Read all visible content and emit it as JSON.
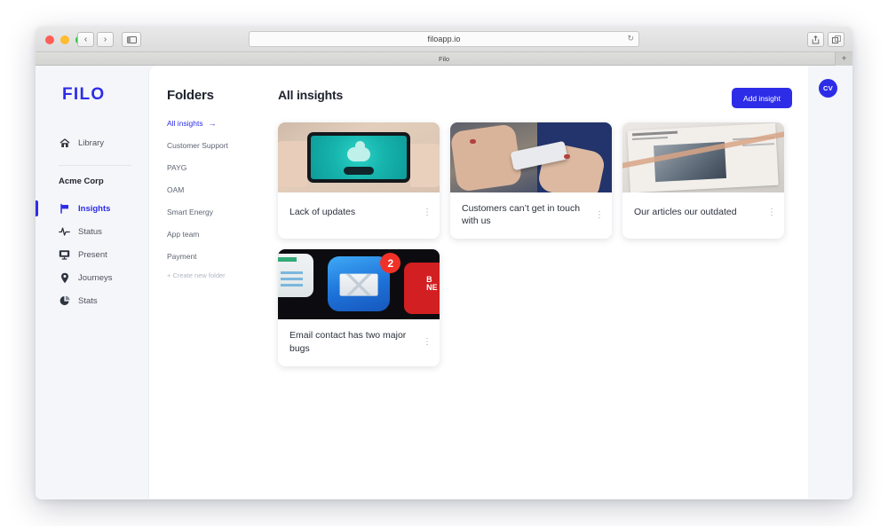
{
  "browser": {
    "url": "filoapp.io",
    "tab_title": "Filo",
    "reload_icon": "reload-icon",
    "back_icon": "‹",
    "forward_icon": "›",
    "sidebar_icon": "sidebar-toggle-icon",
    "share_icon": "share-icon",
    "tabs_icon": "tabs-overview-icon",
    "newtab_label": "+"
  },
  "sidebar": {
    "logo": "FILO",
    "library": {
      "label": "Library",
      "icon": "home-icon"
    },
    "workspace": "Acme Corp",
    "items": [
      {
        "label": "Insights",
        "icon": "flag-icon",
        "active": true
      },
      {
        "label": "Status",
        "icon": "activity-icon",
        "active": false
      },
      {
        "label": "Present",
        "icon": "monitor-icon",
        "active": false
      },
      {
        "label": "Journeys",
        "icon": "map-pin-icon",
        "active": false
      },
      {
        "label": "Stats",
        "icon": "pie-chart-icon",
        "active": false
      }
    ]
  },
  "folders": {
    "title": "Folders",
    "items": [
      {
        "label": "All insights",
        "active": true,
        "arrow": "→"
      },
      {
        "label": "Customer Support",
        "active": false
      },
      {
        "label": "PAYG",
        "active": false
      },
      {
        "label": "OAM",
        "active": false
      },
      {
        "label": "Smart Energy",
        "active": false
      },
      {
        "label": "App team",
        "active": false
      },
      {
        "label": "Payment",
        "active": false
      }
    ],
    "create_label": "+ Create new folder"
  },
  "insights": {
    "title": "All insights",
    "add_button": "Add insight",
    "menu_icon": "⋮",
    "cards": [
      {
        "title": "Lack of updates",
        "art": "art-tablet",
        "image_name": "tablet-vpn-photo"
      },
      {
        "title": "Customers can’t get in touch with us",
        "art": "art-phone",
        "image_name": "hands-phone-photo"
      },
      {
        "title": "Our articles our outdated",
        "art": "art-news",
        "image_name": "newspaper-photo"
      },
      {
        "title": "Email contact has two major bugs",
        "art": "art-email",
        "image_name": "email-app-icon-photo",
        "badge": "2"
      }
    ]
  },
  "account": {
    "avatar_initials": "CV"
  },
  "colors": {
    "accent": "#2d2de8",
    "app_bg": "#f5f6f9",
    "panel": "#ffffff",
    "badge_red": "#f03127"
  }
}
